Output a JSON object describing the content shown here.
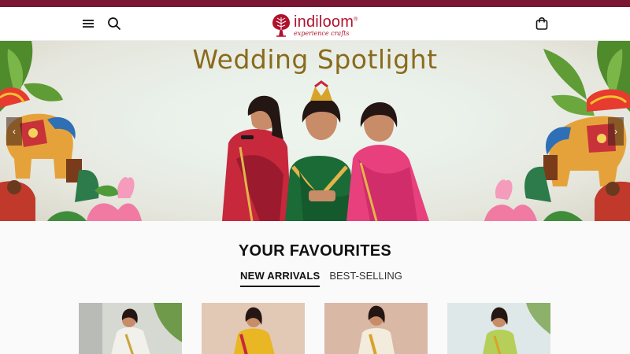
{
  "brand": {
    "name": "indiloom",
    "registered_mark": "®",
    "tagline": "experience crafts",
    "primary_color": "#7a1631",
    "logo_color": "#b0122e"
  },
  "header": {
    "menu_icon": "hamburger-menu-icon",
    "search_icon": "search-icon",
    "cart_icon": "shopping-bag-icon"
  },
  "hero": {
    "title": "Wedding Spotlight",
    "prev_arrow": "‹",
    "next_arrow": "›"
  },
  "favourites": {
    "title": "YOUR FAVOURITES",
    "tabs": [
      {
        "label": "NEW ARRIVALS",
        "active": true
      },
      {
        "label": "BEST-SELLING",
        "active": false
      }
    ]
  }
}
